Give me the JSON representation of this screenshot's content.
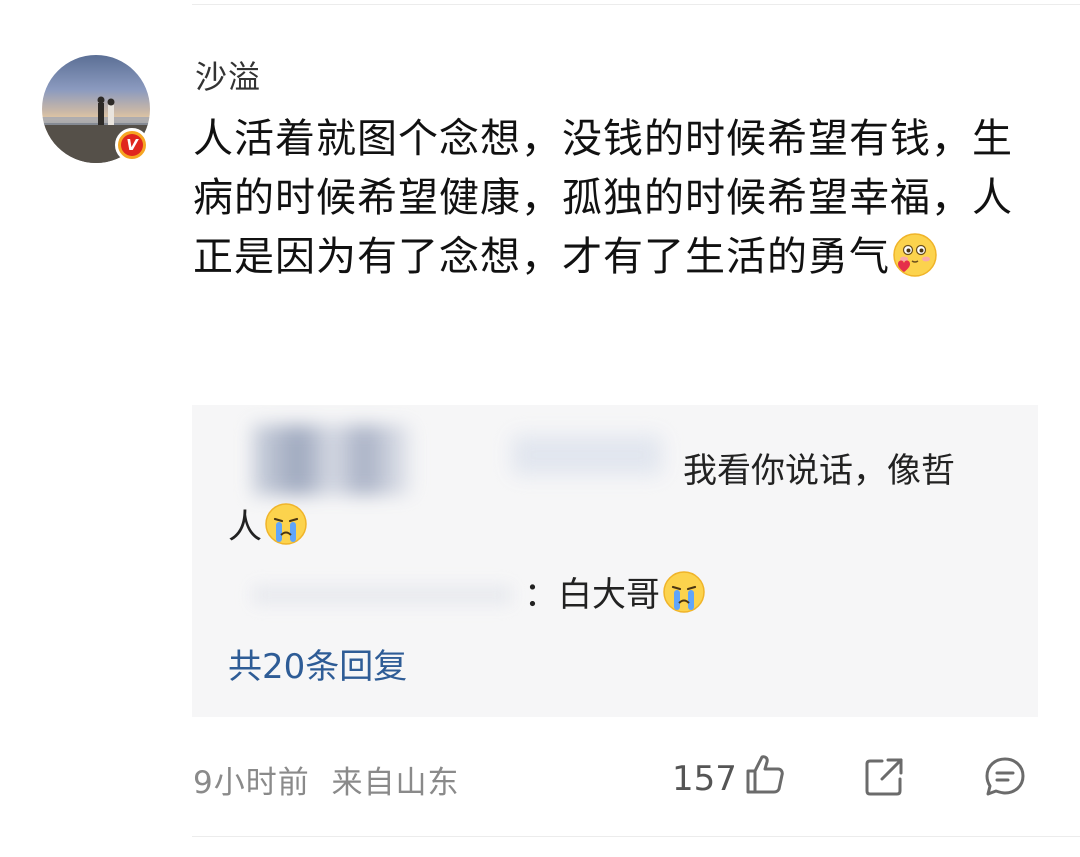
{
  "post": {
    "username": "沙溢",
    "verified_badge": "V",
    "comment_text": "人活着就图个念想，没钱的时候希望有钱，生病的时候希望健康，孤独的时候希望幸福，人正是因为有了念想，才有了生活的勇气",
    "comment_emoji": "blush-heart-emoji"
  },
  "replies": [
    {
      "text": "我看你说话，像哲人",
      "emoji": "crying-emoji"
    },
    {
      "text": "：白大哥",
      "emoji": "crying-emoji"
    }
  ],
  "more_replies_label": "共20条回复",
  "footer": {
    "time": "9小时前",
    "location": "来自山东",
    "like_count": "157"
  },
  "colors": {
    "link_blue": "#2e5c96",
    "reply_bg": "#f6f6f7",
    "badge_orange": "#f5a623",
    "badge_red": "#e0261f"
  }
}
